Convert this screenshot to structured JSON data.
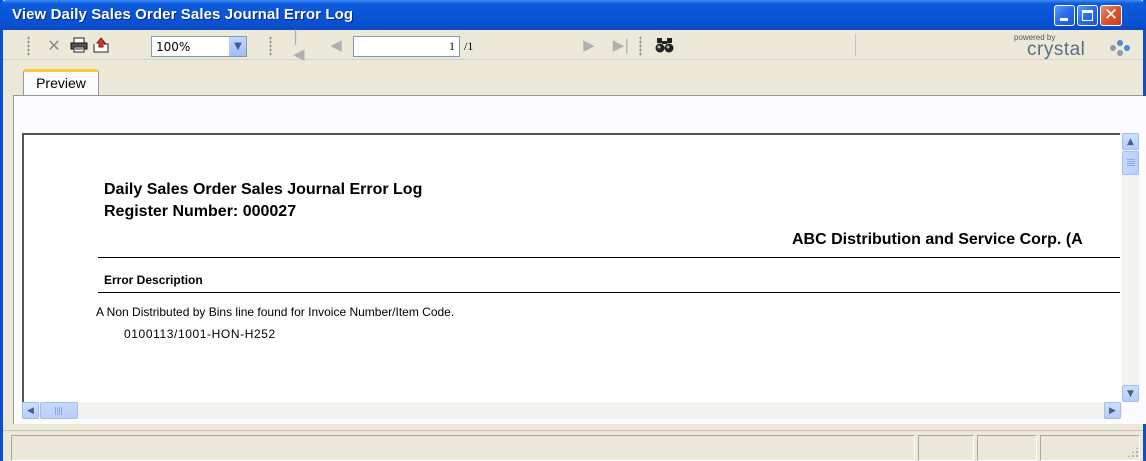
{
  "window": {
    "title": "View Daily Sales Order Sales Journal Error Log",
    "buttons": {
      "minimize": "minimize",
      "maximize": "maximize",
      "close": "close"
    }
  },
  "toolbar": {
    "zoom": {
      "value": "100%",
      "options": [
        "100%"
      ]
    },
    "page": {
      "current": "1",
      "total": "/1"
    },
    "icons": [
      "close-x-icon",
      "print-icon",
      "export-icon",
      "first-page-icon",
      "prev-page-icon",
      "next-page-icon",
      "last-page-icon",
      "find-icon"
    ],
    "logo": {
      "small": "powered by",
      "big": "crystal"
    },
    "colors": {
      "logo_dot_blue": "#4a8bd8",
      "logo_dot_gray": "#8e9aa8"
    }
  },
  "tabs": [
    {
      "label": "Preview",
      "active": true
    }
  ],
  "report": {
    "title": "Daily Sales Order Sales Journal Error Log",
    "register": "Register Number:  000027",
    "company": "ABC Distribution and Service Corp. (A",
    "column_header": "Error Description",
    "rows": [
      {
        "message": "A Non Distributed by Bins line found for Invoice Number/Item Code.",
        "detail": "0100113/1001-HON-H252"
      }
    ]
  },
  "colors": {
    "titlebar": "#0a54d7",
    "tab_accent": "#ffc83c",
    "window_bg": "#ece9d8"
  }
}
